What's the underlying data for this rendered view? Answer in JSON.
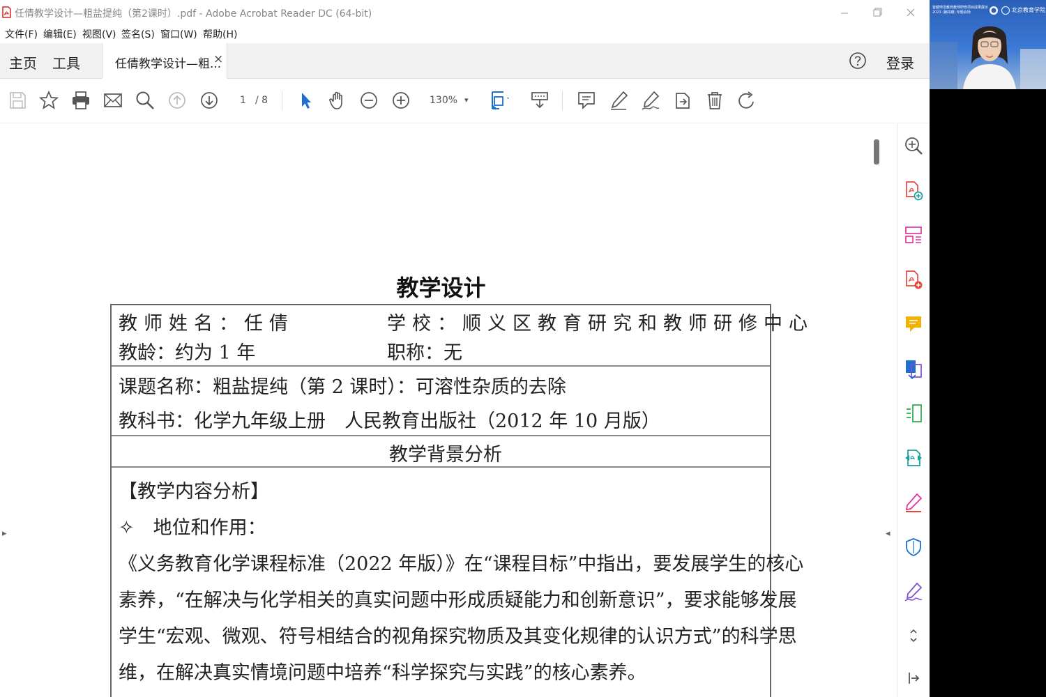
{
  "window": {
    "title": "任倩教学设计—粗盐提纯（第2课时）.pdf - Adobe Acrobat Reader DC (64-bit)"
  },
  "menu": {
    "items": [
      "文件(F)",
      "编辑(E)",
      "视图(V)",
      "签名(S)",
      "窗口(W)",
      "帮助(H)"
    ]
  },
  "tabs": {
    "home": "主页",
    "tools": "工具",
    "doc_tab": "任倩教学设计—粗...",
    "doc_tab_close": "×",
    "login": "登录"
  },
  "toolbar": {
    "page_current": "1",
    "page_total": "/ 8",
    "zoom": "130%",
    "zoom_caret": "▾"
  },
  "document": {
    "title": "教学设计",
    "teacher": "教师姓名：任倩",
    "school": "学校：顺义区教育研究和教师研修中心",
    "teaching_age": "教龄：约为 1 年",
    "title_rank": "职称：无",
    "lesson": "课题名称：粗盐提纯（第 2 课时）：可溶性杂质的去除",
    "textbook": "教科书：化学九年级上册　人民教育出版社（2012 年 10 月版）",
    "section_header": "教学背景分析",
    "subsection": "【教学内容分析】",
    "bullet": "✧　地位和作用：",
    "paragraph_lines": [
      "《义务教育化学课程标准（2022 年版）》在“课程目标”中指出，要发展学生的核心",
      "素养，“在解决与化学相关的真实问题中形成质疑能力和创新意识”，要求能够发展",
      "学生“宏观、微观、符号相结合的视角探究物质及其变化规律的认识方式”的科学思",
      "维，在解决真实情境问题中培养“科学探究与实践”的核心素养。"
    ]
  },
  "nav": {
    "left_collapse": "▸",
    "right_collapse": "◂"
  },
  "video": {
    "banner_left": "首都师范教育教师研修项目成果展示2023 (第四期) 专题会场",
    "banner_right": "北京教育学院"
  },
  "colors": {
    "acrobat_red": "#d4261c",
    "tool_blue": "#1f6fd1",
    "pane_red": "#e8453c",
    "pane_yellow": "#f2b200",
    "pane_green": "#2aa84a",
    "pane_teal": "#14a39b",
    "pane_pink": "#e0379a",
    "pane_purple": "#7d4fd1",
    "icon_gray": "#555555"
  }
}
